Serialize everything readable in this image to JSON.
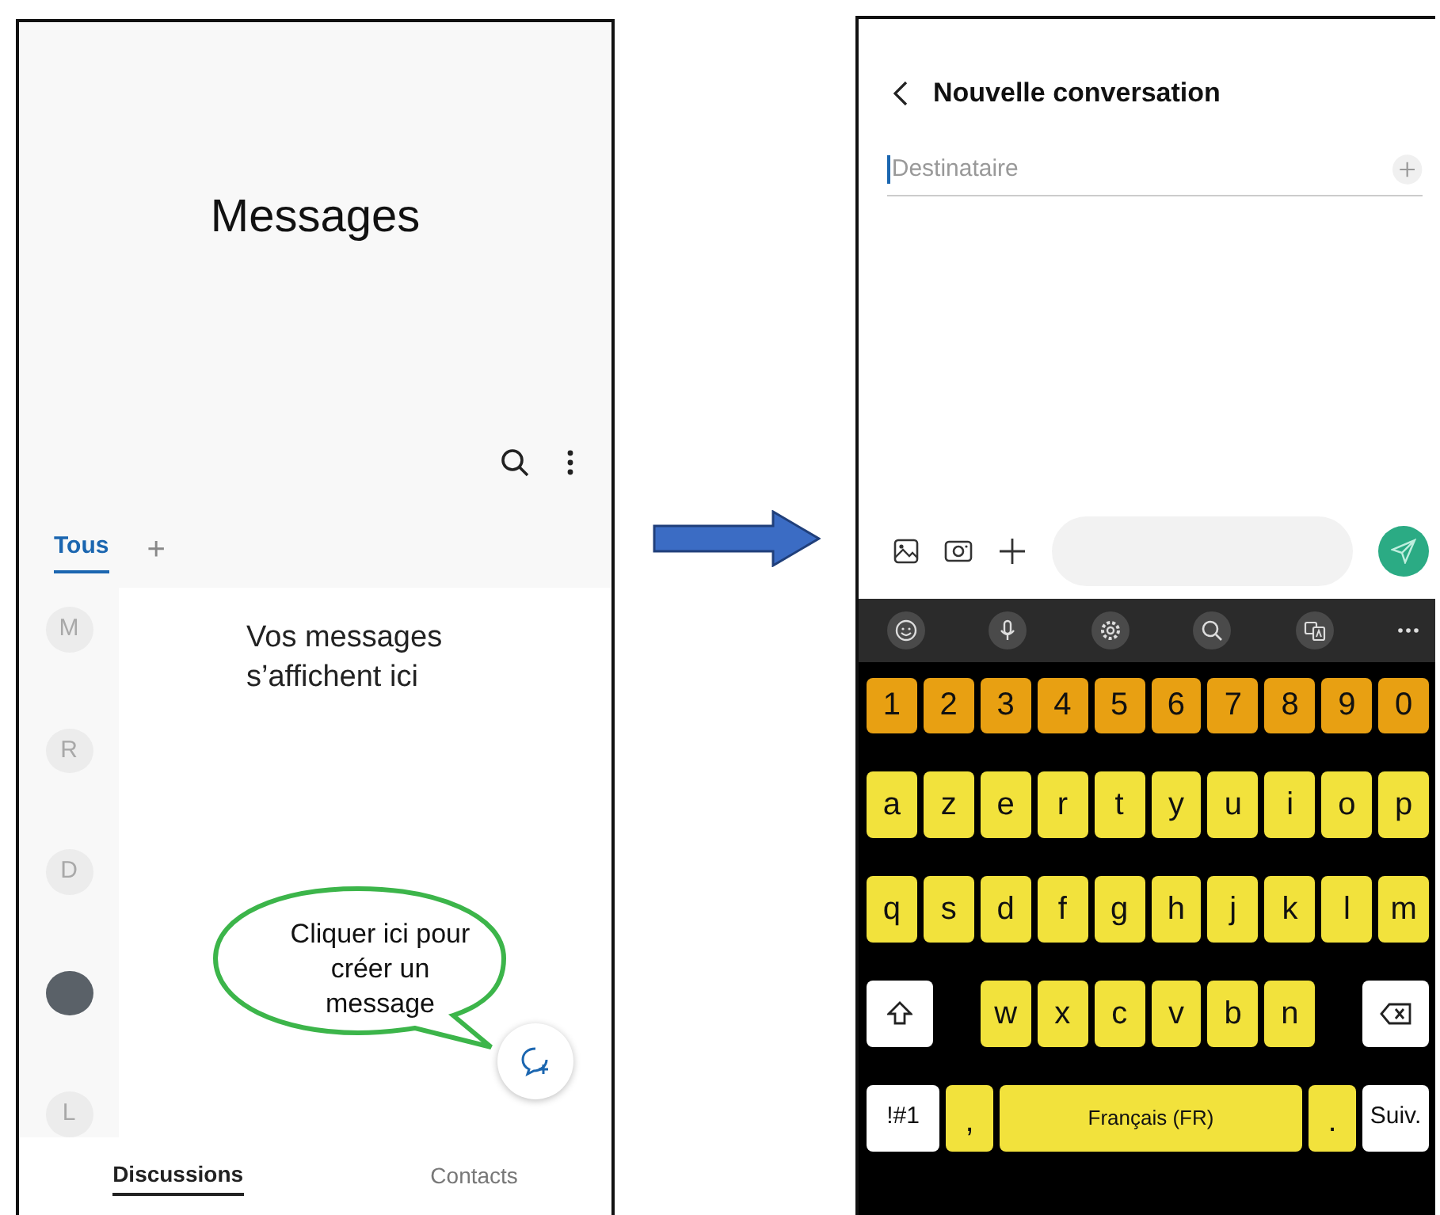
{
  "left_screen": {
    "title": "Messages",
    "tabs": [
      {
        "label": "Tous",
        "selected": true
      },
      {
        "label": "+",
        "selected": false
      }
    ],
    "empty_message": "Vos messages s’affichent ici",
    "conversations": [
      {
        "kind": "letter",
        "initial": "M"
      },
      {
        "kind": "letter",
        "initial": "R"
      },
      {
        "kind": "letter",
        "initial": "D"
      },
      {
        "kind": "photo"
      },
      {
        "kind": "letter",
        "initial": "L"
      }
    ],
    "bottom_tabs": [
      {
        "label": "Discussions",
        "selected": true
      },
      {
        "label": "Contacts",
        "selected": false
      }
    ]
  },
  "callout": {
    "text": "Cliquer ici pour créer un message"
  },
  "right_screen": {
    "title": "Nouvelle conversation",
    "recipient": {
      "placeholder": "Destinataire"
    },
    "keyboard": {
      "rows": [
        {
          "keys": [
            {
              "label": "1",
              "kind": "number"
            },
            {
              "label": "2",
              "kind": "number"
            },
            {
              "label": "3",
              "kind": "number"
            },
            {
              "label": "4",
              "kind": "number"
            },
            {
              "label": "5",
              "kind": "number"
            },
            {
              "label": "6",
              "kind": "number"
            },
            {
              "label": "7",
              "kind": "number"
            },
            {
              "label": "8",
              "kind": "number"
            },
            {
              "label": "9",
              "kind": "number"
            },
            {
              "label": "0",
              "kind": "number"
            }
          ]
        },
        {
          "keys": [
            {
              "label": "a",
              "kind": "letter"
            },
            {
              "label": "z",
              "kind": "letter"
            },
            {
              "label": "e",
              "kind": "letter"
            },
            {
              "label": "r",
              "kind": "letter"
            },
            {
              "label": "t",
              "kind": "letter"
            },
            {
              "label": "y",
              "kind": "letter"
            },
            {
              "label": "u",
              "kind": "letter"
            },
            {
              "label": "i",
              "kind": "letter"
            },
            {
              "label": "o",
              "kind": "letter"
            },
            {
              "label": "p",
              "kind": "letter"
            }
          ]
        },
        {
          "keys": [
            {
              "label": "q",
              "kind": "letter"
            },
            {
              "label": "s",
              "kind": "letter"
            },
            {
              "label": "d",
              "kind": "letter"
            },
            {
              "label": "f",
              "kind": "letter"
            },
            {
              "label": "g",
              "kind": "letter"
            },
            {
              "label": "h",
              "kind": "letter"
            },
            {
              "label": "j",
              "kind": "letter"
            },
            {
              "label": "k",
              "kind": "letter"
            },
            {
              "label": "l",
              "kind": "letter"
            },
            {
              "label": "m",
              "kind": "letter"
            }
          ]
        },
        {
          "keys": [
            {
              "kind": "shift"
            },
            {
              "label": "w",
              "kind": "letter"
            },
            {
              "label": "x",
              "kind": "letter"
            },
            {
              "label": "c",
              "kind": "letter"
            },
            {
              "label": "v",
              "kind": "letter"
            },
            {
              "label": "b",
              "kind": "letter"
            },
            {
              "label": "n",
              "kind": "letter"
            },
            {
              "kind": "backspace"
            }
          ]
        },
        {
          "keys": [
            {
              "label": "!#1",
              "kind": "symbols"
            },
            {
              "label": ",",
              "kind": "comma"
            },
            {
              "label": "Français (FR)",
              "kind": "space"
            },
            {
              "label": ".",
              "kind": "period"
            },
            {
              "label": "Suiv.",
              "kind": "next"
            }
          ]
        }
      ]
    }
  }
}
